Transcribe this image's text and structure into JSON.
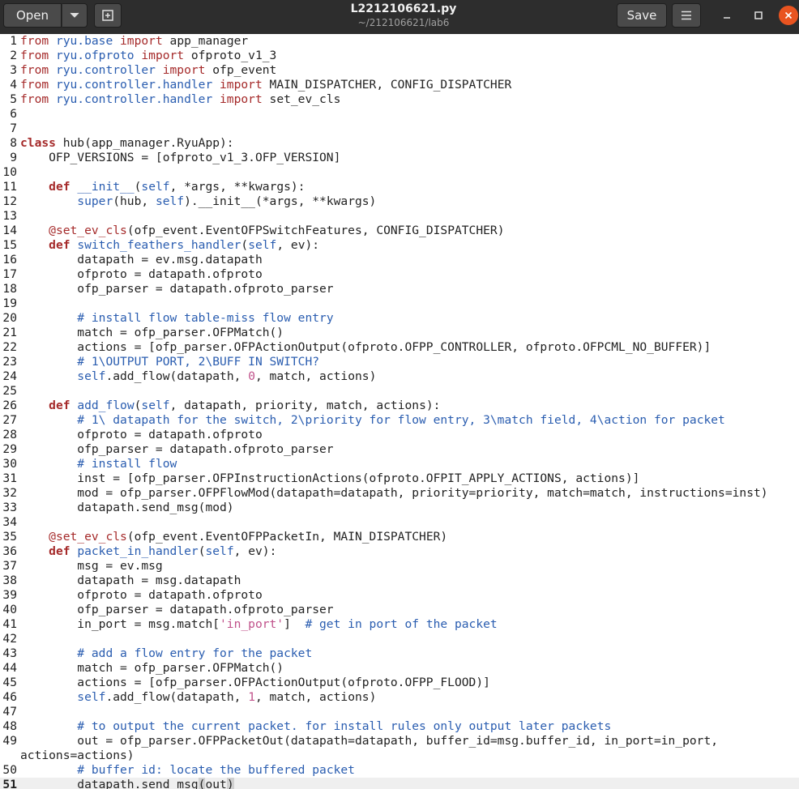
{
  "header": {
    "open_label": "Open",
    "save_label": "Save",
    "title": "L2212106621.py",
    "subtitle": "~/212106621/lab6",
    "icons": {
      "open_menu": "chevron-down-icon",
      "new_tab": "new-tab-icon",
      "menu": "hamburger-menu-icon",
      "minimize": "minimize-icon",
      "maximize": "maximize-icon",
      "close": "close-icon"
    }
  },
  "editor": {
    "language": "python",
    "current_line": "51",
    "colors": {
      "keyword": "#a52a2a",
      "name": "#2a5db0",
      "string": "#c0518a",
      "comment": "#2a5db0"
    },
    "lines": [
      {
        "n": "1",
        "t": [
          [
            "kw",
            "from "
          ],
          [
            "fn",
            "ryu.base"
          ],
          [
            "kw",
            " import "
          ],
          [
            "",
            "app_manager"
          ]
        ]
      },
      {
        "n": "2",
        "t": [
          [
            "kw",
            "from "
          ],
          [
            "fn",
            "ryu.ofproto"
          ],
          [
            "kw",
            " import "
          ],
          [
            "",
            "ofproto_v1_3"
          ]
        ]
      },
      {
        "n": "3",
        "t": [
          [
            "kw",
            "from "
          ],
          [
            "fn",
            "ryu.controller"
          ],
          [
            "kw",
            " import "
          ],
          [
            "",
            "ofp_event"
          ]
        ]
      },
      {
        "n": "4",
        "t": [
          [
            "kw",
            "from "
          ],
          [
            "fn",
            "ryu.controller.handler"
          ],
          [
            "kw",
            " import "
          ],
          [
            "",
            "MAIN_DISPATCHER, CONFIG_DISPATCHER"
          ]
        ]
      },
      {
        "n": "5",
        "t": [
          [
            "kw",
            "from "
          ],
          [
            "fn",
            "ryu.controller.handler"
          ],
          [
            "kw",
            " import "
          ],
          [
            "",
            "set_ev_cls"
          ]
        ]
      },
      {
        "n": "6",
        "t": []
      },
      {
        "n": "7",
        "t": []
      },
      {
        "n": "8",
        "t": [
          [
            "kwb",
            "class "
          ],
          [
            "",
            "hub(app_manager.RyuApp):"
          ]
        ]
      },
      {
        "n": "9",
        "t": [
          [
            "",
            "    OFP_VERSIONS = [ofproto_v1_3.OFP_VERSION]"
          ]
        ]
      },
      {
        "n": "10",
        "t": []
      },
      {
        "n": "11",
        "t": [
          [
            "",
            "    "
          ],
          [
            "kwb",
            "def "
          ],
          [
            "fn",
            "__init__"
          ],
          [
            "",
            "("
          ],
          [
            "bi",
            "self"
          ],
          [
            "",
            ", *args, **kwargs):"
          ]
        ]
      },
      {
        "n": "12",
        "t": [
          [
            "",
            "        "
          ],
          [
            "bi",
            "super"
          ],
          [
            "",
            "(hub, "
          ],
          [
            "bi",
            "self"
          ],
          [
            "",
            ").__init__(*args, **kwargs)"
          ]
        ]
      },
      {
        "n": "13",
        "t": []
      },
      {
        "n": "14",
        "t": [
          [
            "",
            "    "
          ],
          [
            "kw",
            "@set_ev_cls"
          ],
          [
            "",
            "(ofp_event.EventOFPSwitchFeatures, CONFIG_DISPATCHER)"
          ]
        ]
      },
      {
        "n": "15",
        "t": [
          [
            "",
            "    "
          ],
          [
            "kwb",
            "def "
          ],
          [
            "fn",
            "switch_feathers_handler"
          ],
          [
            "",
            "("
          ],
          [
            "bi",
            "self"
          ],
          [
            "",
            ", ev):"
          ]
        ]
      },
      {
        "n": "16",
        "t": [
          [
            "",
            "        datapath = ev.msg.datapath"
          ]
        ]
      },
      {
        "n": "17",
        "t": [
          [
            "",
            "        ofproto = datapath.ofproto"
          ]
        ]
      },
      {
        "n": "18",
        "t": [
          [
            "",
            "        ofp_parser = datapath.ofproto_parser"
          ]
        ]
      },
      {
        "n": "19",
        "t": []
      },
      {
        "n": "20",
        "t": [
          [
            "",
            "        "
          ],
          [
            "cm",
            "# install flow table-miss flow entry"
          ]
        ]
      },
      {
        "n": "21",
        "t": [
          [
            "",
            "        match = ofp_parser.OFPMatch()"
          ]
        ]
      },
      {
        "n": "22",
        "t": [
          [
            "",
            "        actions = [ofp_parser.OFPActionOutput(ofproto.OFPP_CONTROLLER, ofproto.OFPCML_NO_BUFFER)]"
          ]
        ]
      },
      {
        "n": "23",
        "t": [
          [
            "",
            "        "
          ],
          [
            "cm",
            "# 1\\OUTPUT PORT, 2\\BUFF IN SWITCH?"
          ]
        ]
      },
      {
        "n": "24",
        "t": [
          [
            "",
            "        "
          ],
          [
            "bi",
            "self"
          ],
          [
            "",
            ".add_flow(datapath, "
          ],
          [
            "nm",
            "0"
          ],
          [
            "",
            ", match, actions)"
          ]
        ]
      },
      {
        "n": "25",
        "t": []
      },
      {
        "n": "26",
        "t": [
          [
            "",
            "    "
          ],
          [
            "kwb",
            "def "
          ],
          [
            "fn",
            "add_flow"
          ],
          [
            "",
            "("
          ],
          [
            "bi",
            "self"
          ],
          [
            "",
            ", datapath, priority, match, actions):"
          ]
        ]
      },
      {
        "n": "27",
        "t": [
          [
            "",
            "        "
          ],
          [
            "cm",
            "# 1\\ datapath for the switch, 2\\priority for flow entry, 3\\match field, 4\\action for packet"
          ]
        ]
      },
      {
        "n": "28",
        "t": [
          [
            "",
            "        ofproto = datapath.ofproto"
          ]
        ]
      },
      {
        "n": "29",
        "t": [
          [
            "",
            "        ofp_parser = datapath.ofproto_parser"
          ]
        ]
      },
      {
        "n": "30",
        "t": [
          [
            "",
            "        "
          ],
          [
            "cm",
            "# install flow"
          ]
        ]
      },
      {
        "n": "31",
        "t": [
          [
            "",
            "        inst = [ofp_parser.OFPInstructionActions(ofproto.OFPIT_APPLY_ACTIONS, actions)]"
          ]
        ]
      },
      {
        "n": "32",
        "t": [
          [
            "",
            "        mod = ofp_parser.OFPFlowMod(datapath=datapath, priority=priority, match=match, instructions=inst)"
          ]
        ]
      },
      {
        "n": "33",
        "t": [
          [
            "",
            "        datapath.send_msg(mod)"
          ]
        ]
      },
      {
        "n": "34",
        "t": []
      },
      {
        "n": "35",
        "t": [
          [
            "",
            "    "
          ],
          [
            "kw",
            "@set_ev_cls"
          ],
          [
            "",
            "(ofp_event.EventOFPPacketIn, MAIN_DISPATCHER)"
          ]
        ]
      },
      {
        "n": "36",
        "t": [
          [
            "",
            "    "
          ],
          [
            "kwb",
            "def "
          ],
          [
            "fn",
            "packet_in_handler"
          ],
          [
            "",
            "("
          ],
          [
            "bi",
            "self"
          ],
          [
            "",
            ", ev):"
          ]
        ]
      },
      {
        "n": "37",
        "t": [
          [
            "",
            "        msg = ev.msg"
          ]
        ]
      },
      {
        "n": "38",
        "t": [
          [
            "",
            "        datapath = msg.datapath"
          ]
        ]
      },
      {
        "n": "39",
        "t": [
          [
            "",
            "        ofproto = datapath.ofproto"
          ]
        ]
      },
      {
        "n": "40",
        "t": [
          [
            "",
            "        ofp_parser = datapath.ofproto_parser"
          ]
        ]
      },
      {
        "n": "41",
        "t": [
          [
            "",
            "        in_port = msg.match["
          ],
          [
            "st",
            "'in_port'"
          ],
          [
            "",
            "]  "
          ],
          [
            "cm",
            "# get in port of the packet"
          ]
        ]
      },
      {
        "n": "42",
        "t": []
      },
      {
        "n": "43",
        "t": [
          [
            "",
            "        "
          ],
          [
            "cm",
            "# add a flow entry for the packet"
          ]
        ]
      },
      {
        "n": "44",
        "t": [
          [
            "",
            "        match = ofp_parser.OFPMatch()"
          ]
        ]
      },
      {
        "n": "45",
        "t": [
          [
            "",
            "        actions = [ofp_parser.OFPActionOutput(ofproto.OFPP_FLOOD)]"
          ]
        ]
      },
      {
        "n": "46",
        "t": [
          [
            "",
            "        "
          ],
          [
            "bi",
            "self"
          ],
          [
            "",
            ".add_flow(datapath, "
          ],
          [
            "nm",
            "1"
          ],
          [
            "",
            ", match, actions)"
          ]
        ]
      },
      {
        "n": "47",
        "t": []
      },
      {
        "n": "48",
        "t": [
          [
            "",
            "        "
          ],
          [
            "cm",
            "# to output the current packet. for install rules only output later packets"
          ]
        ]
      },
      {
        "n": "49",
        "t": [
          [
            "",
            "        out = ofp_parser.OFPPacketOut(datapath=datapath, buffer_id=msg.buffer_id, in_port=in_port,"
          ]
        ]
      },
      {
        "n": "",
        "t": [
          [
            "",
            "actions=actions)"
          ]
        ],
        "wrap": true
      },
      {
        "n": "50",
        "t": [
          [
            "",
            "        "
          ],
          [
            "cm",
            "# buffer id: locate the buffered packet"
          ]
        ]
      },
      {
        "n": "51",
        "t": [
          [
            "",
            "        datapath.send_msg"
          ],
          [
            "cursor-box",
            "("
          ],
          [
            "",
            "out"
          ],
          [
            "cursor-box",
            ")"
          ]
        ]
      }
    ]
  }
}
